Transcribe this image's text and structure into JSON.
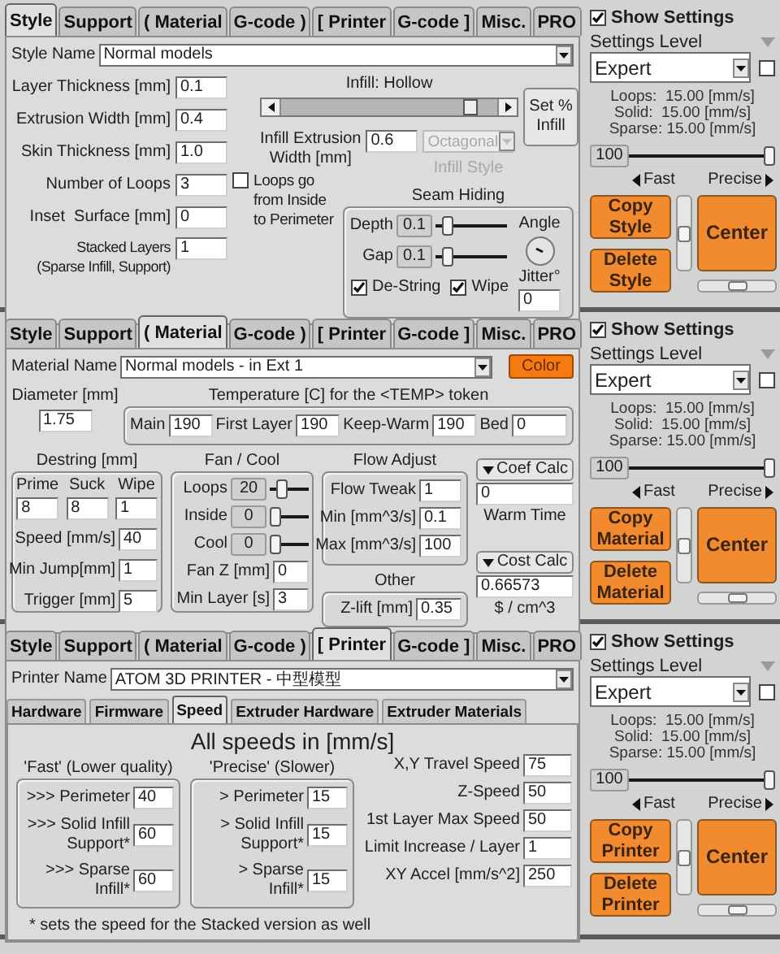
{
  "panels": [
    {
      "kind": "style",
      "tabs": [
        {
          "label": "Style",
          "selected": true
        },
        {
          "label": "Support",
          "selected": false
        },
        {
          "label": "( Material",
          "selected": false
        },
        {
          "label": "G-code )",
          "selected": false
        },
        {
          "label": "[ Printer",
          "selected": false
        },
        {
          "label": "G-code ]",
          "selected": false
        },
        {
          "label": "Misc.",
          "selected": false
        },
        {
          "label": "PRO",
          "selected": false
        }
      ],
      "name_field": {
        "label": "Style Name",
        "value": "Normal models"
      },
      "fields": [
        {
          "label": "Layer Thickness [mm]",
          "value": "0.1"
        },
        {
          "label": "Extrusion Width [mm]",
          "value": "0.4"
        },
        {
          "label": "Skin Thickness [mm]",
          "value": "1.0"
        },
        {
          "label": "Number of Loops",
          "value": "3"
        },
        {
          "label": "Inset  Surface [mm]",
          "value": "0"
        },
        {
          "label": "Stacked Layers\n(Sparse Infill, Support)",
          "value": "1"
        }
      ],
      "loops_order": {
        "label": "Loops go\nfrom Inside\nto Perimeter",
        "checked": false
      },
      "infill": {
        "title": "Infill: Hollow",
        "level": 0.9,
        "width_label": "Infill Extrusion\nWidth [mm]",
        "width_value": "0.6",
        "style_value": "Octagonal",
        "style_label": "Infill Style",
        "disabled": true,
        "button": "Set %\nInfill"
      },
      "seam": {
        "title": "Seam Hiding",
        "sliders": [
          {
            "label": "Depth",
            "value": "0.1",
            "level": 0.1
          },
          {
            "label": "Gap",
            "value": "0.1",
            "level": 0.1
          }
        ],
        "angle_label": "Angle",
        "jitter_label": "Jitter°",
        "jitter_value": "0",
        "checks": [
          {
            "label": "De-String",
            "checked": true
          },
          {
            "label": "Wipe",
            "checked": true
          }
        ]
      },
      "sidebar": {
        "show_settings": {
          "label": "Show Settings",
          "checked": true
        },
        "level_label": "Settings Level",
        "level_value": "Expert",
        "extra_checkbox": {
          "checked": false
        },
        "speeds": [
          "Loops:  15.00 [mm/s]",
          "Solid:  15.00 [mm/s]",
          "Sparse: 15.00 [mm/s]"
        ],
        "quality": {
          "value": "100",
          "level": 1
        },
        "fast": "Fast",
        "precise": "Precise",
        "buttons": [
          "Copy\nStyle",
          "Delete\nStyle"
        ],
        "center": "Center"
      }
    },
    {
      "kind": "material",
      "tabs": [
        {
          "label": "Style",
          "selected": false
        },
        {
          "label": "Support",
          "selected": false
        },
        {
          "label": "( Material",
          "selected": true
        },
        {
          "label": "G-code )",
          "selected": false
        },
        {
          "label": "[ Printer",
          "selected": false
        },
        {
          "label": "G-code ]",
          "selected": false
        },
        {
          "label": "Misc.",
          "selected": false
        },
        {
          "label": "PRO",
          "selected": false
        }
      ],
      "name_field": {
        "label": "Material Name",
        "value": "Normal models - in Ext 1"
      },
      "color_button": "Color",
      "diameter": {
        "label": "Diameter [mm]",
        "value": "1.75"
      },
      "temperature": {
        "title": "Temperature [C] for the <TEMP> token",
        "fields": [
          {
            "label": "Main",
            "value": "190"
          },
          {
            "label": "First Layer",
            "value": "190"
          },
          {
            "label": "Keep-Warm",
            "value": "190"
          },
          {
            "label": "Bed",
            "value": "0"
          }
        ]
      },
      "destring": {
        "title": "Destring [mm]",
        "columns": [
          {
            "label": "Prime",
            "value": "8"
          },
          {
            "label": "Suck",
            "value": "8"
          },
          {
            "label": "Wipe",
            "value": "1"
          }
        ],
        "fields": [
          {
            "label": "Speed [mm/s]",
            "value": "40"
          },
          {
            "label": "Min Jump[mm]",
            "value": "1"
          },
          {
            "label": "Trigger [mm]",
            "value": "5"
          }
        ]
      },
      "fan": {
        "title": "Fan / Cool",
        "sliders": [
          {
            "label": "Loops",
            "value": "20",
            "level": 0.25
          },
          {
            "label": "Inside",
            "value": "0",
            "level": 0
          },
          {
            "label": "Cool",
            "value": "0",
            "level": 0
          }
        ],
        "fields": [
          {
            "label": "Fan Z [mm]",
            "value": "0"
          },
          {
            "label": "Min Layer [s]",
            "value": "3"
          }
        ]
      },
      "flow": {
        "title": "Flow Adjust",
        "fields": [
          {
            "label": "Flow Tweak",
            "value": "1"
          },
          {
            "label": "Min [mm^3/s]",
            "value": "0.1"
          },
          {
            "label": "Max [mm^3/s]",
            "value": "100"
          }
        ]
      },
      "other": {
        "title": "Other",
        "fields": [
          {
            "label": "Z-lift [mm]",
            "value": "0.35"
          }
        ]
      },
      "calcs": [
        {
          "button": "Coef Calc",
          "value": "0",
          "caption": "Warm Time"
        },
        {
          "button": "Cost Calc",
          "value": "0.66573",
          "caption": "$ / cm^3"
        }
      ],
      "sidebar": {
        "show_settings": {
          "label": "Show Settings",
          "checked": true
        },
        "level_label": "Settings Level",
        "level_value": "Expert",
        "extra_checkbox": {
          "checked": false
        },
        "speeds": [
          "Loops:  15.00 [mm/s]",
          "Solid:  15.00 [mm/s]",
          "Sparse: 15.00 [mm/s]"
        ],
        "quality": {
          "value": "100",
          "level": 1
        },
        "fast": "Fast",
        "precise": "Precise",
        "buttons": [
          "Copy\nMaterial",
          "Delete\nMaterial"
        ],
        "center": "Center"
      }
    },
    {
      "kind": "printer",
      "tabs": [
        {
          "label": "Style",
          "selected": false
        },
        {
          "label": "Support",
          "selected": false
        },
        {
          "label": "( Material",
          "selected": false
        },
        {
          "label": "G-code )",
          "selected": false
        },
        {
          "label": "[ Printer",
          "selected": true
        },
        {
          "label": "G-code ]",
          "selected": false
        },
        {
          "label": "Misc.",
          "selected": false
        },
        {
          "label": "PRO",
          "selected": false
        }
      ],
      "name_field": {
        "label": "Printer Name",
        "value": "ATOM 3D PRINTER - 中型模型"
      },
      "subtabs": [
        {
          "label": "Hardware",
          "selected": false
        },
        {
          "label": "Firmware",
          "selected": false
        },
        {
          "label": "Speed",
          "selected": true
        },
        {
          "label": "Extruder Hardware",
          "selected": false
        },
        {
          "label": "Extruder Materials",
          "selected": false
        }
      ],
      "heading": "All speeds in [mm/s]",
      "groups": [
        {
          "title": "'Fast' (Lower quality)",
          "fields": [
            {
              "label": ">>> Perimeter",
              "value": "40"
            },
            {
              "label": ">>> Solid Infill\nSupport*",
              "value": "60"
            },
            {
              "label": ">>> Sparse\nInfill*",
              "value": "60"
            }
          ]
        },
        {
          "title": "'Precise' (Slower)",
          "fields": [
            {
              "label": "> Perimeter",
              "value": "15"
            },
            {
              "label": "> Solid Infill\nSupport*",
              "value": "15"
            },
            {
              "label": "> Sparse\nInfill*",
              "value": "15"
            }
          ]
        }
      ],
      "fields": [
        {
          "label": "X,Y Travel Speed",
          "value": "75"
        },
        {
          "label": "Z-Speed",
          "value": "50"
        },
        {
          "label": "1st Layer Max Speed",
          "value": "50"
        },
        {
          "label": "Limit Increase / Layer",
          "value": "1"
        },
        {
          "label": "XY Accel [mm/s^2]",
          "value": "250"
        }
      ],
      "footnote": "* sets the speed for the Stacked version as well",
      "sidebar": {
        "show_settings": {
          "label": "Show Settings",
          "checked": true
        },
        "level_label": "Settings Level",
        "level_value": "Expert",
        "extra_checkbox": {
          "checked": false
        },
        "speeds": [
          "Loops:  15.00 [mm/s]",
          "Solid:  15.00 [mm/s]",
          "Sparse: 15.00 [mm/s]"
        ],
        "quality": {
          "value": "100",
          "level": 1
        },
        "fast": "Fast",
        "precise": "Precise",
        "buttons": [
          "Copy\nPrinter",
          "Delete\nPrinter"
        ],
        "center": "Center"
      }
    }
  ]
}
